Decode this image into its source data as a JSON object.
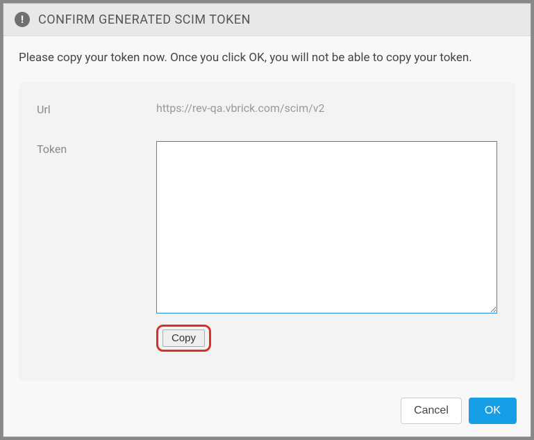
{
  "header": {
    "title": "CONFIRM GENERATED SCIM TOKEN"
  },
  "body": {
    "instruction": "Please copy your token now. Once you click OK, you will not be able to copy your token.",
    "fields": {
      "url": {
        "label": "Url",
        "value": "https://rev-qa.vbrick.com/scim/v2"
      },
      "token": {
        "label": "Token",
        "value": ""
      }
    },
    "copyButton": "Copy"
  },
  "footer": {
    "cancel": "Cancel",
    "ok": "OK"
  }
}
